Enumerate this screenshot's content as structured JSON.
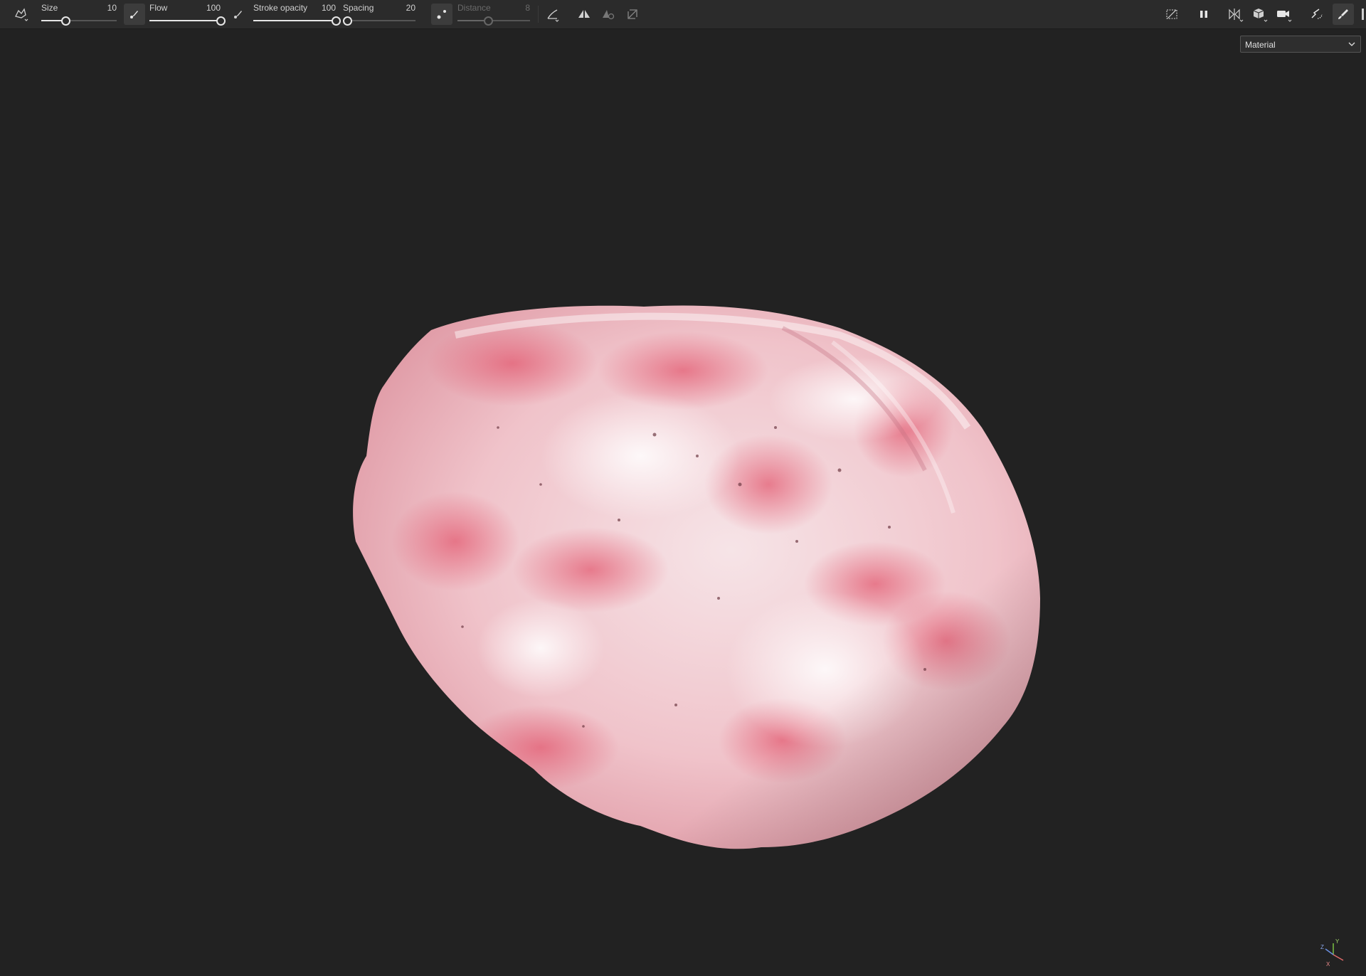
{
  "toolbar": {
    "tool_icon": "brush-preset-icon",
    "params": {
      "size": {
        "label": "Size",
        "value": "10",
        "fraction": 0.32
      },
      "flow": {
        "label": "Flow",
        "value": "100",
        "fraction": 1.0
      },
      "stroke_opacity": {
        "label": "Stroke opacity",
        "value": "100",
        "fraction": 1.0
      },
      "spacing": {
        "label": "Spacing",
        "value": "20",
        "fraction": 0.06
      },
      "distance": {
        "label": "Distance",
        "value": "8",
        "fraction": 0.42,
        "disabled": true
      }
    },
    "right_icons": [
      "hide-overlay-icon",
      "pause-icon",
      "symmetry-icon",
      "cube-view-icon",
      "camera-icon",
      "lazy-mouse-icon",
      "paint-brush-icon"
    ]
  },
  "viewport": {
    "display_mode": {
      "selected": "Material"
    },
    "colors": {
      "background": "#222222",
      "object_base": "#f2c9cf",
      "object_accent": "#e46c80"
    },
    "axis_gizmo": {
      "x": "X",
      "y": "Y",
      "z": "Z"
    }
  }
}
